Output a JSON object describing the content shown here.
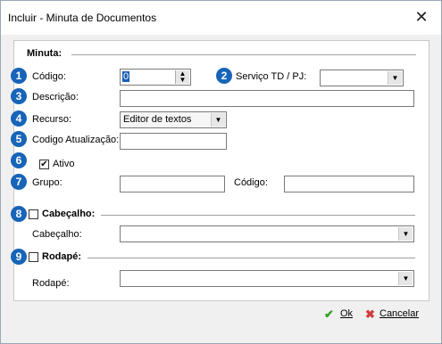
{
  "window": {
    "title": "Incluir - Minuta de Documentos",
    "close_icon": "close-icon"
  },
  "minuta": {
    "group_label": "Minuta:"
  },
  "fields": {
    "codigo": {
      "badge": "1",
      "label": "Código:",
      "value": "0"
    },
    "servico": {
      "badge": "2",
      "label": "Serviço TD / PJ:",
      "value": ""
    },
    "descricao": {
      "badge": "3",
      "label": "Descrição:",
      "value": ""
    },
    "recurso": {
      "badge": "4",
      "label": "Recurso:",
      "value": "Editor de textos"
    },
    "codigo_atualizacao": {
      "badge": "5",
      "label": "Codigo Atualização:",
      "value": ""
    },
    "ativo": {
      "badge": "6",
      "label": "Ativo",
      "checked": true
    },
    "grupo": {
      "badge": "7",
      "label": "Grupo:",
      "value": "",
      "codigo_label": "Código:",
      "codigo_value": ""
    }
  },
  "cabecalho": {
    "badge": "8",
    "group_label": "Cabeçalho:",
    "checked": false,
    "label": "Cabeçalho:",
    "value": ""
  },
  "rodape": {
    "badge": "9",
    "group_label": "Rodapé:",
    "checked": false,
    "label": "Rodapé:",
    "value": ""
  },
  "footer": {
    "ok_label": "Ok",
    "cancel_label": "Cancelar"
  },
  "colors": {
    "badge": "#1764b8",
    "ok_icon": "#3aa02a",
    "cancel_icon": "#d23b3b"
  }
}
